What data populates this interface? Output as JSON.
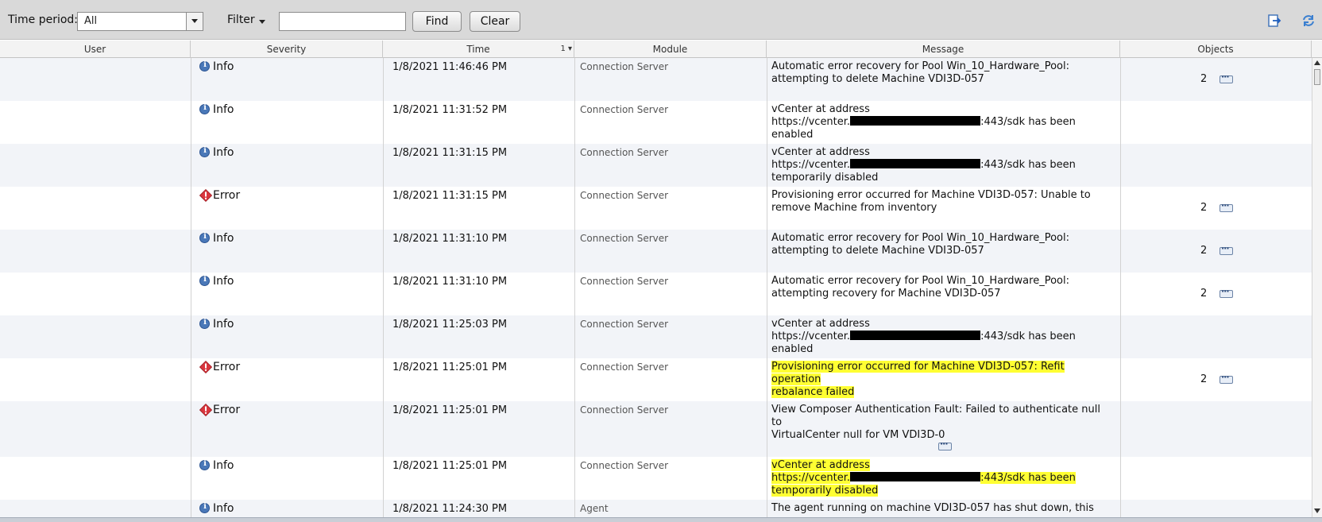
{
  "toolbar": {
    "time_period_label": "Time period:",
    "time_period_value": "All",
    "filter_label": "Filter",
    "filter_value": "",
    "find_label": "Find",
    "clear_label": "Clear",
    "export_icon": "export-icon",
    "refresh_icon": "refresh-icon"
  },
  "columns": {
    "user": "User",
    "severity": "Severity",
    "time": "Time",
    "time_sort": "1 ▾",
    "module": "Module",
    "message": "Message",
    "objects": "Objects"
  },
  "colors": {
    "highlight": "#ffff33",
    "info_icon": "#4a78b8",
    "error_icon": "#d9363e",
    "alt_row": "#f2f4f8"
  },
  "rows": [
    {
      "severity": "Info",
      "time": "1/8/2021 11:46:46 PM",
      "module": "Connection Server",
      "msg_lines": [
        "Automatic error recovery for Pool Win_10_Hardware_Pool:",
        "attempting to delete Machine VDI3D-057"
      ],
      "objects": "2"
    },
    {
      "severity": "Info",
      "time": "1/8/2021 11:31:52 PM",
      "module": "Connection Server",
      "msg_lines": [
        "vCenter at address",
        "https://vcenter.",
        ":443/sdk has been",
        "enabled"
      ],
      "objects": ""
    },
    {
      "severity": "Info",
      "time": "1/8/2021 11:31:15 PM",
      "module": "Connection Server",
      "msg_lines": [
        "vCenter at address",
        "https://vcenter.",
        ":443/sdk has been",
        "temporarily disabled"
      ],
      "objects": ""
    },
    {
      "severity": "Error",
      "time": "1/8/2021 11:31:15 PM",
      "module": "Connection Server",
      "msg_lines": [
        "Provisioning error occurred for Machine VDI3D-057: Unable to",
        "remove Machine from inventory"
      ],
      "objects": "2"
    },
    {
      "severity": "Info",
      "time": "1/8/2021 11:31:10 PM",
      "module": "Connection Server",
      "msg_lines": [
        "Automatic error recovery for Pool Win_10_Hardware_Pool:",
        "attempting to delete Machine VDI3D-057"
      ],
      "objects": "2"
    },
    {
      "severity": "Info",
      "time": "1/8/2021 11:31:10 PM",
      "module": "Connection Server",
      "msg_lines": [
        "Automatic error recovery for Pool Win_10_Hardware_Pool:",
        "attempting recovery for Machine VDI3D-057"
      ],
      "objects": "2"
    },
    {
      "severity": "Info",
      "time": "1/8/2021 11:25:03 PM",
      "module": "Connection Server",
      "msg_lines": [
        "vCenter at address",
        "https://vcenter.",
        ":443/sdk has been",
        "enabled"
      ],
      "objects": ""
    },
    {
      "severity": "Error",
      "time": "1/8/2021 11:25:01 PM",
      "module": "Connection Server",
      "msg_lines": [
        "Provisioning error occurred for Machine VDI3D-057: Refit operation",
        "rebalance failed"
      ],
      "objects": "2"
    },
    {
      "severity": "Error",
      "time": "1/8/2021 11:25:01 PM",
      "module": "Connection Server",
      "msg_lines": [
        "View Composer Authentication Fault: Failed to authenticate null to",
        "VirtualCenter null for VM VDI3D-0"
      ],
      "objects": ""
    },
    {
      "severity": "Info",
      "time": "1/8/2021 11:25:01 PM",
      "module": "Connection Server",
      "msg_lines": [
        "vCenter at address",
        "https://vcenter.",
        ":443/sdk has been",
        "temporarily disabled"
      ],
      "objects": ""
    },
    {
      "severity": "Info",
      "time": "1/8/2021 11:24:30 PM",
      "module": "Agent",
      "msg_lines": [
        "The agent running on machine VDI3D-057 has shut down, this"
      ],
      "objects": ""
    }
  ]
}
